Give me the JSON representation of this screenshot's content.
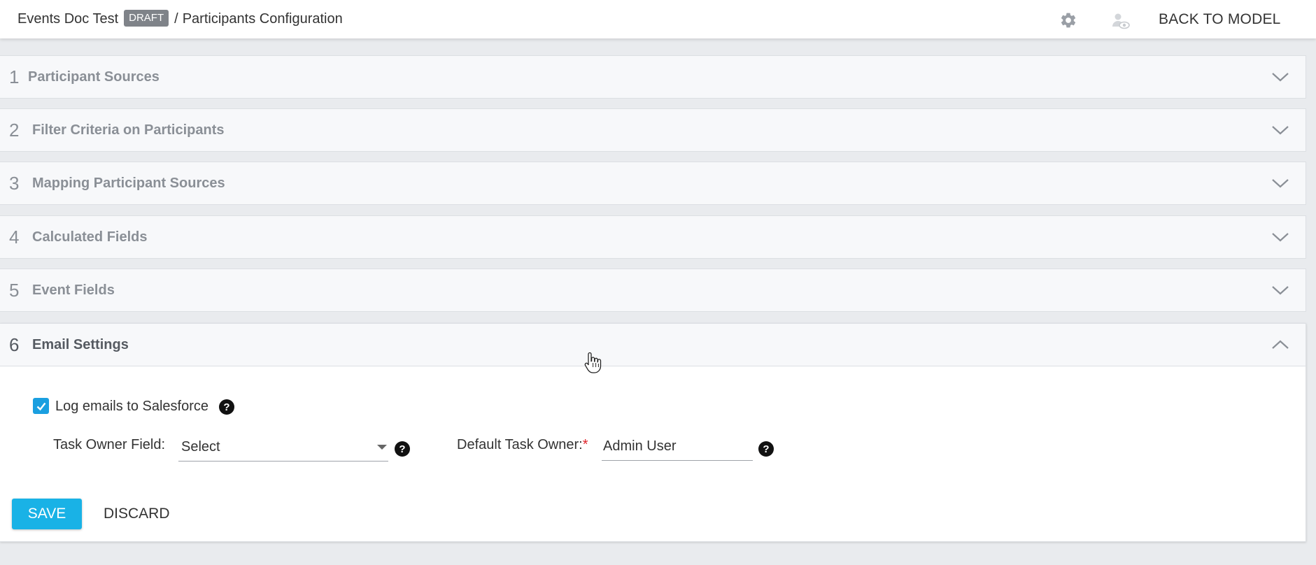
{
  "header": {
    "doc_title": "Events Doc Test",
    "draft_badge": "DRAFT",
    "separator": "/",
    "page_title": "Participants Configuration",
    "settings_icon": "gear-icon",
    "preview_icon": "preview-user-icon",
    "back_label": "BACK TO MODEL"
  },
  "sections": [
    {
      "number": "1",
      "title": "Participant Sources",
      "state": "collapsed"
    },
    {
      "number": "2",
      "title": "Filter Criteria on Participants",
      "state": "collapsed"
    },
    {
      "number": "3",
      "title": "Mapping Participant Sources",
      "state": "collapsed"
    },
    {
      "number": "4",
      "title": "Calculated Fields",
      "state": "collapsed"
    },
    {
      "number": "5",
      "title": "Event Fields",
      "state": "collapsed"
    },
    {
      "number": "6",
      "title": "Email Settings",
      "state": "expanded"
    }
  ],
  "email_settings": {
    "log_emails_label": "Log emails to Salesforce",
    "log_emails_checked": true,
    "task_owner_field_label": "Task Owner Field:",
    "task_owner_field_value": "Select",
    "default_task_owner_label": "Default Task Owner:",
    "required_mark": "*",
    "default_task_owner_value": "Admin User",
    "help_glyph": "?"
  },
  "actions": {
    "save_label": "SAVE",
    "discard_label": "DISCARD"
  },
  "colors": {
    "accent": "#19b2e6",
    "checkbox": "#1a9fe0",
    "draft_badge": "#7f8389",
    "required": "#e0242b"
  }
}
